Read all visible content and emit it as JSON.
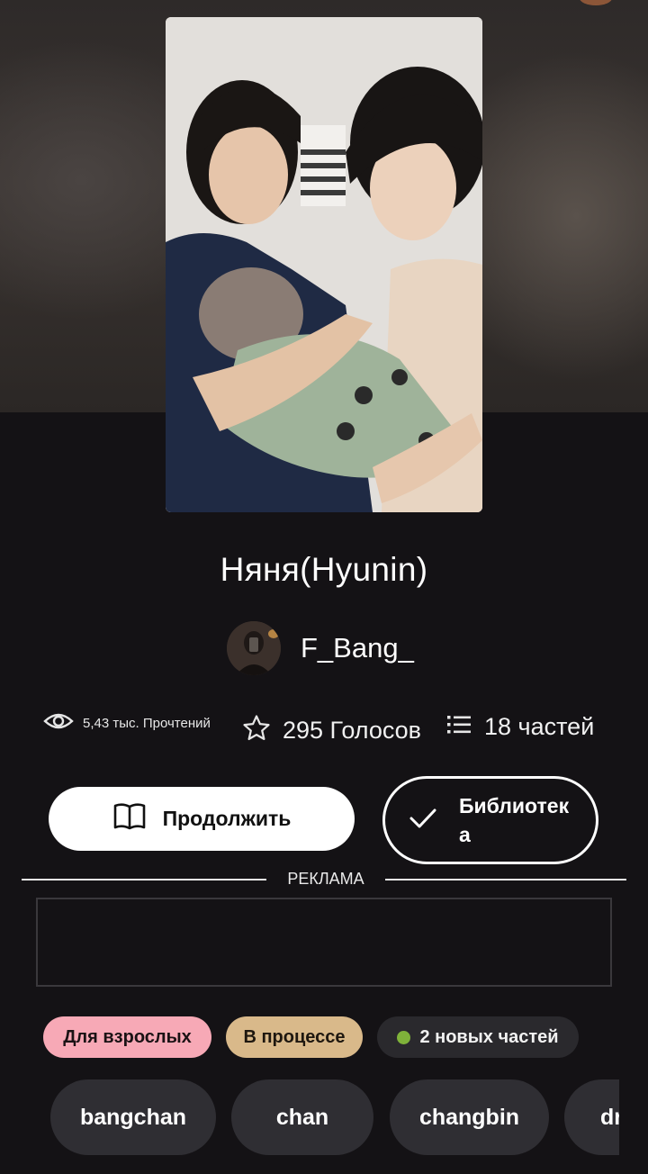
{
  "story": {
    "title": "Няня(Hyunin)",
    "author": "F_Bang_"
  },
  "stats": {
    "views": "5,43 тыс. Прочтений",
    "votes": "295 Голосов",
    "parts": "18 частей"
  },
  "actions": {
    "continue_label": "Продолжить",
    "library_label": "Библиотека"
  },
  "ad": {
    "label": "РЕКЛАМА"
  },
  "badges": {
    "mature": "Для взрослых",
    "status": "В процессе",
    "new_parts": "2 новых частей"
  },
  "tags": [
    "bangchan",
    "chan",
    "changbin",
    "dr"
  ],
  "colors": {
    "background": "#141215",
    "mature_badge": "#f7a9b6",
    "status_badge": "#d9b98a",
    "new_dot": "#7fb23a",
    "tag_bg": "#2f2e33"
  },
  "icons": {
    "views": "eye-icon",
    "votes": "star-icon",
    "parts": "list-icon",
    "continue": "book-icon",
    "library": "check-icon"
  }
}
